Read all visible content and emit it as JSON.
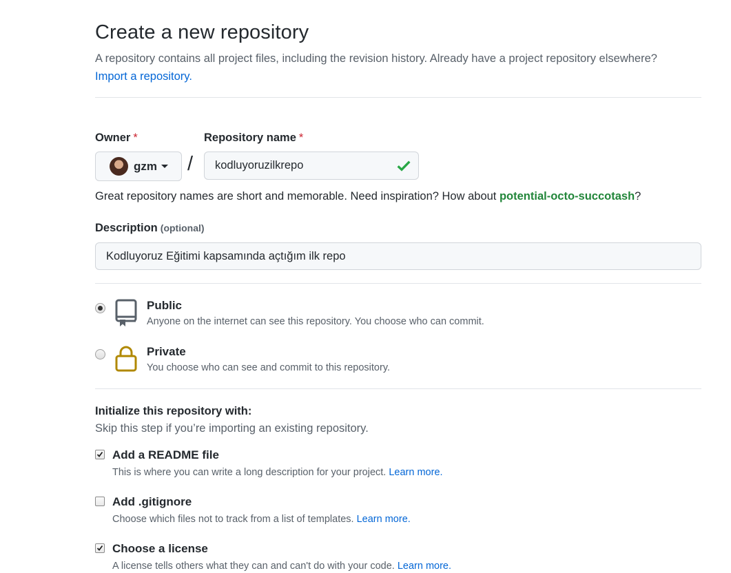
{
  "header": {
    "title": "Create a new repository",
    "intro": "A repository contains all project files, including the revision history. Already have a project repository elsewhere?",
    "import_link": "Import a repository."
  },
  "owner": {
    "label": "Owner",
    "required_mark": "*",
    "name": "gzm"
  },
  "repo": {
    "label": "Repository name",
    "required_mark": "*",
    "value": "kodluyoruzilkrepo",
    "slash": "/"
  },
  "hint": {
    "text": "Great repository names are short and memorable. Need inspiration? How about ",
    "suggestion": "potential-octo-succotash",
    "end": "?"
  },
  "description": {
    "label": "Description",
    "optional": "(optional)",
    "value": "Kodluyoruz Eğitimi kapsamında açtığım ilk repo"
  },
  "visibility": {
    "public": {
      "title": "Public",
      "desc": "Anyone on the internet can see this repository. You choose who can commit.",
      "selected": true
    },
    "private": {
      "title": "Private",
      "desc": "You choose who can see and commit to this repository.",
      "selected": false
    }
  },
  "init": {
    "title": "Initialize this repository with:",
    "subtitle": "Skip this step if you’re importing an existing repository.",
    "options": [
      {
        "title": "Add a README file",
        "desc": "This is where you can write a long description for your project.",
        "link": "Learn more.",
        "checked": true
      },
      {
        "title": "Add .gitignore",
        "desc": "Choose which files not to track from a list of templates.",
        "link": "Learn more.",
        "checked": false
      },
      {
        "title": "Choose a license",
        "desc": "A license tells others what they can and can't do with your code.",
        "link": "Learn more.",
        "checked": true
      }
    ]
  },
  "colors": {
    "link": "#0366d6",
    "success": "#28a745",
    "suggestion": "#22863a",
    "required": "#cb2431",
    "lock": "#b08800"
  }
}
